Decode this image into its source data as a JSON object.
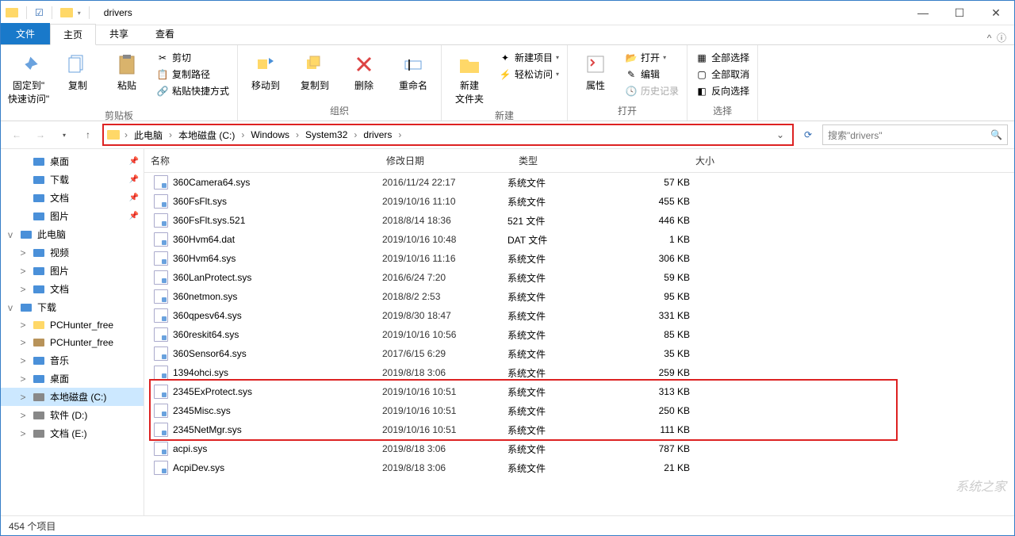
{
  "window": {
    "title": "drivers"
  },
  "tabs": {
    "file": "文件",
    "home": "主页",
    "share": "共享",
    "view": "查看"
  },
  "ribbon": {
    "clipboard": {
      "label": "剪贴板",
      "pin": "固定到\"\n快速访问\"",
      "copy": "复制",
      "paste": "粘贴",
      "cut": "剪切",
      "copypath": "复制路径",
      "paste_shortcut": "粘贴快捷方式"
    },
    "organize": {
      "label": "组织",
      "moveto": "移动到",
      "copyto": "复制到",
      "delete": "删除",
      "rename": "重命名"
    },
    "new": {
      "label": "新建",
      "newfolder": "新建\n文件夹",
      "newitem": "新建项目",
      "easyaccess": "轻松访问"
    },
    "open": {
      "label": "打开",
      "properties": "属性",
      "open": "打开",
      "edit": "编辑",
      "history": "历史记录"
    },
    "select": {
      "label": "选择",
      "selectall": "全部选择",
      "selectnone": "全部取消",
      "invert": "反向选择"
    }
  },
  "breadcrumb": {
    "segments": [
      "此电脑",
      "本地磁盘 (C:)",
      "Windows",
      "System32",
      "drivers"
    ]
  },
  "search": {
    "placeholder": "搜索\"drivers\""
  },
  "navpane": [
    {
      "indent": 1,
      "exp": "",
      "icon": "desktop",
      "label": "桌面",
      "pin": true
    },
    {
      "indent": 1,
      "exp": "",
      "icon": "downloads",
      "label": "下载",
      "pin": true
    },
    {
      "indent": 1,
      "exp": "",
      "icon": "documents",
      "label": "文档",
      "pin": true
    },
    {
      "indent": 1,
      "exp": "",
      "icon": "pictures",
      "label": "图片",
      "pin": true
    },
    {
      "indent": 0,
      "exp": "v",
      "icon": "thispc",
      "label": "此电脑"
    },
    {
      "indent": 1,
      "exp": ">",
      "icon": "videos",
      "label": "视频"
    },
    {
      "indent": 1,
      "exp": ">",
      "icon": "pictures",
      "label": "图片"
    },
    {
      "indent": 1,
      "exp": ">",
      "icon": "documents",
      "label": "文档"
    },
    {
      "indent": 0,
      "exp": "v",
      "icon": "downloads",
      "label": "下载"
    },
    {
      "indent": 1,
      "exp": ">",
      "icon": "folder",
      "label": "PCHunter_free"
    },
    {
      "indent": 1,
      "exp": ">",
      "icon": "archive",
      "label": "PCHunter_free"
    },
    {
      "indent": 1,
      "exp": ">",
      "icon": "music",
      "label": "音乐"
    },
    {
      "indent": 1,
      "exp": ">",
      "icon": "desktop",
      "label": "桌面"
    },
    {
      "indent": 1,
      "exp": ">",
      "icon": "disk",
      "label": "本地磁盘 (C:)",
      "selected": true
    },
    {
      "indent": 1,
      "exp": ">",
      "icon": "disk",
      "label": "软件 (D:)"
    },
    {
      "indent": 1,
      "exp": ">",
      "icon": "disk",
      "label": "文档 (E:)"
    }
  ],
  "columns": {
    "name": "名称",
    "date": "修改日期",
    "type": "类型",
    "size": "大小"
  },
  "files": [
    {
      "name": "360Camera64.sys",
      "date": "2016/11/24 22:17",
      "type": "系统文件",
      "size": "57 KB"
    },
    {
      "name": "360FsFlt.sys",
      "date": "2019/10/16 11:10",
      "type": "系统文件",
      "size": "455 KB"
    },
    {
      "name": "360FsFlt.sys.521",
      "date": "2018/8/14 18:36",
      "type": "521 文件",
      "size": "446 KB"
    },
    {
      "name": "360Hvm64.dat",
      "date": "2019/10/16 10:48",
      "type": "DAT 文件",
      "size": "1 KB"
    },
    {
      "name": "360Hvm64.sys",
      "date": "2019/10/16 11:16",
      "type": "系统文件",
      "size": "306 KB"
    },
    {
      "name": "360LanProtect.sys",
      "date": "2016/6/24 7:20",
      "type": "系统文件",
      "size": "59 KB"
    },
    {
      "name": "360netmon.sys",
      "date": "2018/8/2 2:53",
      "type": "系统文件",
      "size": "95 KB"
    },
    {
      "name": "360qpesv64.sys",
      "date": "2019/8/30 18:47",
      "type": "系统文件",
      "size": "331 KB"
    },
    {
      "name": "360reskit64.sys",
      "date": "2019/10/16 10:56",
      "type": "系统文件",
      "size": "85 KB"
    },
    {
      "name": "360Sensor64.sys",
      "date": "2017/6/15 6:29",
      "type": "系统文件",
      "size": "35 KB"
    },
    {
      "name": "1394ohci.sys",
      "date": "2019/8/18 3:06",
      "type": "系统文件",
      "size": "259 KB"
    },
    {
      "name": "2345ExProtect.sys",
      "date": "2019/10/16 10:51",
      "type": "系统文件",
      "size": "313 KB"
    },
    {
      "name": "2345Misc.sys",
      "date": "2019/10/16 10:51",
      "type": "系统文件",
      "size": "250 KB"
    },
    {
      "name": "2345NetMgr.sys",
      "date": "2019/10/16 10:51",
      "type": "系统文件",
      "size": "111 KB"
    },
    {
      "name": "acpi.sys",
      "date": "2019/8/18 3:06",
      "type": "系统文件",
      "size": "787 KB"
    },
    {
      "name": "AcpiDev.sys",
      "date": "2019/8/18 3:06",
      "type": "系统文件",
      "size": "21 KB"
    }
  ],
  "status": {
    "count": "454 个项目"
  },
  "watermark": "系统之家"
}
